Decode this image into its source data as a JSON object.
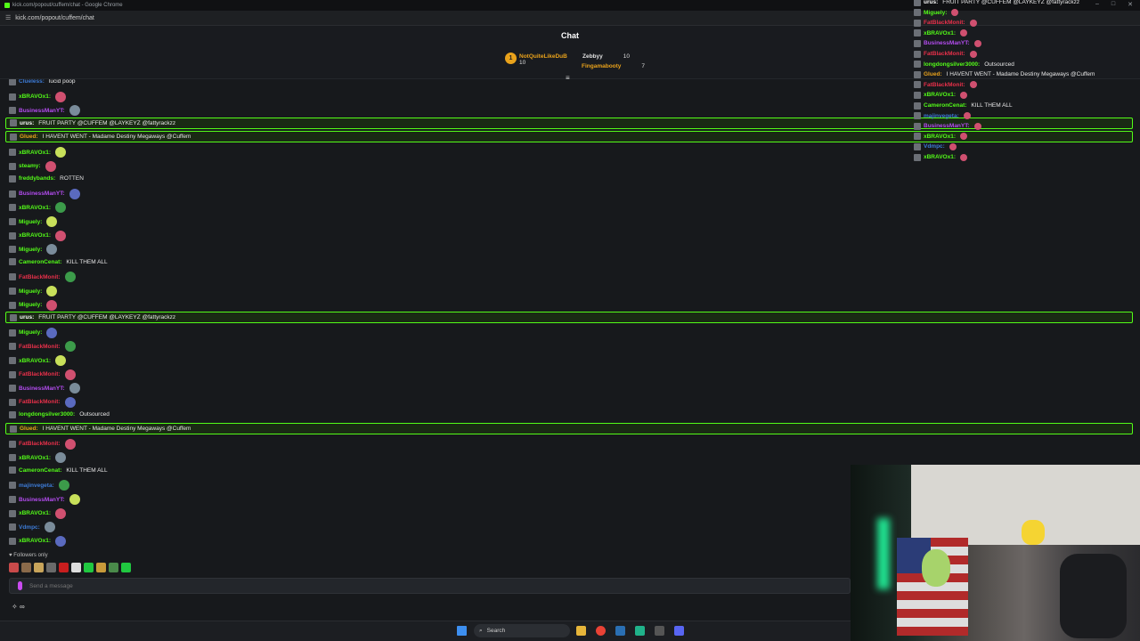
{
  "window": {
    "title": "kick.com/popout/cuffem/chat - Google Chrome",
    "url": "kick.com/popout/cuffem/chat"
  },
  "header": {
    "title": "Chat"
  },
  "gifters": [
    {
      "name": "NotQuiteLikeDuB",
      "count": "10",
      "color": "#e9a21b"
    },
    {
      "name": "Zebbyy",
      "count": "10",
      "color": "#e0e0e0"
    },
    {
      "name": "Fingamabooty",
      "count": "7",
      "color": "#e9a21b"
    }
  ],
  "gifter_rank": "1",
  "messages": [
    {
      "user": "Clueless:",
      "text": "lucid poop",
      "color": "#3d7bd6",
      "hl": false
    },
    {
      "user": "xBRAVOx1:",
      "text": "",
      "color": "#53fc18",
      "hl": false
    },
    {
      "user": "BusinessManYT:",
      "text": "",
      "color": "#b44cf0",
      "hl": false
    },
    {
      "user": "urus:",
      "text": "FRUIT PARTY @CUFFEM @LAYKEYZ @fattyrackzz",
      "color": "#ffffff",
      "hl": true
    },
    {
      "user": "Glued:",
      "text": "I HAVENT WENT - Madame Destiny Megaways @Cuffem",
      "color": "#e9a21b",
      "hl": true
    },
    {
      "user": "xBRAVOx1:",
      "text": "",
      "color": "#53fc18",
      "hl": false
    },
    {
      "user": "steamy:",
      "text": "",
      "color": "#53fc18",
      "hl": false
    },
    {
      "user": "freddybands:",
      "text": "ROTTEN",
      "color": "#53fc18",
      "hl": false
    },
    {
      "user": "BusinessManYT:",
      "text": "",
      "color": "#b44cf0",
      "hl": false
    },
    {
      "user": "xBRAVOx1:",
      "text": "",
      "color": "#53fc18",
      "hl": false
    },
    {
      "user": "Miguely:",
      "text": "",
      "color": "#53fc18",
      "hl": false
    },
    {
      "user": "xBRAVOx1:",
      "text": "",
      "color": "#53fc18",
      "hl": false
    },
    {
      "user": "Miguely:",
      "text": "",
      "color": "#53fc18",
      "hl": false
    },
    {
      "user": "CameronCenat:",
      "text": "KILL THEM ALL",
      "color": "#53fc18",
      "hl": false
    },
    {
      "user": "FatBlackMonit:",
      "text": "",
      "color": "#e8304a",
      "hl": false
    },
    {
      "user": "Miguely:",
      "text": "",
      "color": "#53fc18",
      "hl": false
    },
    {
      "user": "Miguely:",
      "text": "",
      "color": "#53fc18",
      "hl": false
    },
    {
      "user": "urus:",
      "text": "FRUIT PARTY @CUFFEM @LAYKEYZ @fattyrackzz",
      "color": "#ffffff",
      "hl": true
    },
    {
      "user": "Miguely:",
      "text": "",
      "color": "#53fc18",
      "hl": false
    },
    {
      "user": "FatBlackMonit:",
      "text": "",
      "color": "#e8304a",
      "hl": false
    },
    {
      "user": "xBRAVOx1:",
      "text": "",
      "color": "#53fc18",
      "hl": false
    },
    {
      "user": "FatBlackMonit:",
      "text": "",
      "color": "#e8304a",
      "hl": false
    },
    {
      "user": "BusinessManYT:",
      "text": "",
      "color": "#b44cf0",
      "hl": false
    },
    {
      "user": "FatBlackMonit:",
      "text": "",
      "color": "#e8304a",
      "hl": false
    },
    {
      "user": "longdongsilver3000:",
      "text": "Outsourced",
      "color": "#53fc18",
      "hl": false
    },
    {
      "user": "Glued:",
      "text": "I HAVENT WENT - Madame Destiny Megaways @Cuffem",
      "color": "#e9a21b",
      "hl": true
    },
    {
      "user": "FatBlackMonit:",
      "text": "",
      "color": "#e8304a",
      "hl": false
    },
    {
      "user": "xBRAVOx1:",
      "text": "",
      "color": "#53fc18",
      "hl": false
    },
    {
      "user": "CameronCenat:",
      "text": "KILL THEM ALL",
      "color": "#53fc18",
      "hl": false
    },
    {
      "user": "majinvegeta:",
      "text": "",
      "color": "#3d7bd6",
      "hl": false
    },
    {
      "user": "BusinessManYT:",
      "text": "",
      "color": "#b44cf0",
      "hl": false
    },
    {
      "user": "xBRAVOx1:",
      "text": "",
      "color": "#53fc18",
      "hl": false
    },
    {
      "user": "Vdmpc:",
      "text": "",
      "color": "#3d7bd6",
      "hl": false
    },
    {
      "user": "xBRAVOx1:",
      "text": "",
      "color": "#53fc18",
      "hl": false
    }
  ],
  "overlay_messages": [
    {
      "user": "urus:",
      "text": "FRUIT PARTY @CUFFEM @LAYKEYZ @fattyrackzz",
      "color": "#ffffff"
    },
    {
      "user": "Miguely:",
      "text": "",
      "color": "#53fc18"
    },
    {
      "user": "FatBlackMonit:",
      "text": "",
      "color": "#e8304a"
    },
    {
      "user": "xBRAVOx1:",
      "text": "",
      "color": "#53fc18"
    },
    {
      "user": "BusinessManYT:",
      "text": "",
      "color": "#b44cf0"
    },
    {
      "user": "FatBlackMonit:",
      "text": "",
      "color": "#e8304a"
    },
    {
      "user": "longdongsilver3000:",
      "text": "Outsourced",
      "color": "#53fc18"
    },
    {
      "user": "Glued:",
      "text": "I HAVENT WENT - Madame Destiny Megaways @Cuffem",
      "color": "#e9a21b"
    },
    {
      "user": "FatBlackMonit:",
      "text": "",
      "color": "#e8304a"
    },
    {
      "user": "xBRAVOx1:",
      "text": "",
      "color": "#53fc18"
    },
    {
      "user": "CameronCenat:",
      "text": "KILL THEM ALL",
      "color": "#53fc18"
    },
    {
      "user": "majinvegeta:",
      "text": "",
      "color": "#3d7bd6"
    },
    {
      "user": "BusinessManYT:",
      "text": "",
      "color": "#b44cf0"
    },
    {
      "user": "xBRAVOx1:",
      "text": "",
      "color": "#53fc18"
    },
    {
      "user": "Vdmpc:",
      "text": "",
      "color": "#3d7bd6"
    },
    {
      "user": "xBRAVOx1:",
      "text": "",
      "color": "#53fc18"
    }
  ],
  "footer": {
    "followers_only": "Followers only",
    "input_placeholder": "Send a message"
  },
  "taskbar": {
    "search_label": "Search"
  }
}
